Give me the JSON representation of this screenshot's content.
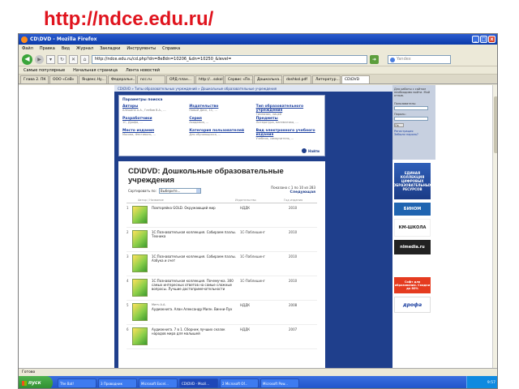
{
  "slide": {
    "title": "http://ndce.edu.ru/"
  },
  "window": {
    "title": "CD\\DVD - Mozilla Firefox",
    "controls": [
      "_",
      "□",
      "x"
    ]
  },
  "menu": [
    "Файл",
    "Правка",
    "Вид",
    "Журнал",
    "Закладки",
    "Инструменты",
    "Справка"
  ],
  "nav": {
    "url": "http://ndce.edu.ru/cd.php?dn=8e8dn=10206_&dn=10250_&level=",
    "search_placeholder": "Yandex"
  },
  "bookmarks": [
    "Самые популярные",
    "Начальная страница",
    "Лента новостей"
  ],
  "tabs": [
    "Глава 2. ПК",
    "ООО «CеВ»",
    "Яндекс.Ну...",
    "Федеральн...",
    "ncc.ru",
    "ОРД план...",
    "http://...sokol",
    "Сервис «Пе...",
    "Дошкольна...",
    "doshkol.pdf",
    "Литератур...",
    "CD\\DVD"
  ],
  "page": {
    "breadcrumb": "CD\\DVD » Типы образовательных учреждений » Дошкольные образовательные учреждения",
    "filter": {
      "title": "Параметры поиска",
      "items": [
        {
          "label": "Авторы",
          "sub": "Алешина А.А., Глебов В.А., ..."
        },
        {
          "label": "Издательство",
          "sub": "Новый Диск, 1С, ..."
        },
        {
          "label": "Тип образовательного учреждения",
          "sub": "Гимназии, лицей"
        },
        {
          "label": "Разработчики",
          "sub": "1С, Дрофа, ..."
        },
        {
          "label": "Серия",
          "sub": "Академия, ..."
        },
        {
          "label": "Предметы",
          "sub": "Литература, математика, ..."
        },
        {
          "label": "Место издания",
          "sub": "Москва, Фестиваль, ..."
        },
        {
          "label": "Категория пользователей",
          "sub": "Для обучающихся, ..."
        },
        {
          "label": "Вид электронного учебного издания",
          "sub": "Учебник, самоучитель, ..."
        }
      ],
      "find": "Найти"
    },
    "list": {
      "title": "CD\\DVD: Дошкольные образовательные учреждения",
      "sort_label": "Сортировать по:",
      "sort_value": "Выберите...",
      "shown": "Показано с 1 по 10 из 283",
      "next": "Следующая",
      "columns": [
        "",
        "Автор / Название",
        "Издательство",
        "Год издания"
      ],
      "rows": [
        {
          "num": "1",
          "author": "",
          "title": "Повторяйка GOLD. Окружающий мир",
          "publisher": "НДДК",
          "year": "2010"
        },
        {
          "num": "2",
          "author": "",
          "title": "1С:Познавательная коллекция. Собираем пазлы. Техника",
          "publisher": "1С-Паблишинг",
          "year": "2010"
        },
        {
          "num": "3",
          "author": "",
          "title": "1С:Познавательная коллекция. Собираем пазлы. Азбука и счет",
          "publisher": "1С-Паблишинг",
          "year": "2010"
        },
        {
          "num": "4",
          "author": "",
          "title": "1С:Познавательная коллекция. Почемучка. 300 самых интересных ответов на самые сложные вопросы. Лучшие достопримечательности",
          "publisher": "1С-Паблишинг",
          "year": "2010"
        },
        {
          "num": "5",
          "author": "Митч А.А.",
          "title": "Аудиокнига. Алан Александр Милн. Винни-Пух",
          "publisher": "НДДК",
          "year": "2008"
        },
        {
          "num": "6",
          "author": "",
          "title": "Аудиокнига. 7 в 1. Сборник лучших сказок народов мира для малышей",
          "publisher": "НДДК",
          "year": "2007"
        }
      ]
    }
  },
  "sidebar": {
    "login_note": "Для работы с сайтом необходимо войти. Мой отзыв.",
    "user_label": "Пользователь:",
    "pass_label": "Пароль:",
    "ok_label": "Ок",
    "links": [
      "Регистрация",
      "Забыли пароль?"
    ],
    "banners": [
      "ЕДИНАЯ КОЛЛЕКЦИЯ ЦИФРОВЫХ ОБРАЗОВАТЕЛЬНЫХ РЕСУРСОВ",
      "БИНОМ",
      "КМ-ШКОЛА",
      "nlmedia.ru",
      "Софт для образования. Скидки до 80%",
      "дрофа"
    ]
  },
  "status": "Готово",
  "taskbar": {
    "start": "пуск",
    "tasks": [
      "The Bat!",
      "3 Проводник",
      "Microsoft Excel...",
      "CD\\DVD - Mozil...",
      "2 Microsoft Of...",
      "Microsoft Pow..."
    ],
    "clock": "9:57"
  }
}
